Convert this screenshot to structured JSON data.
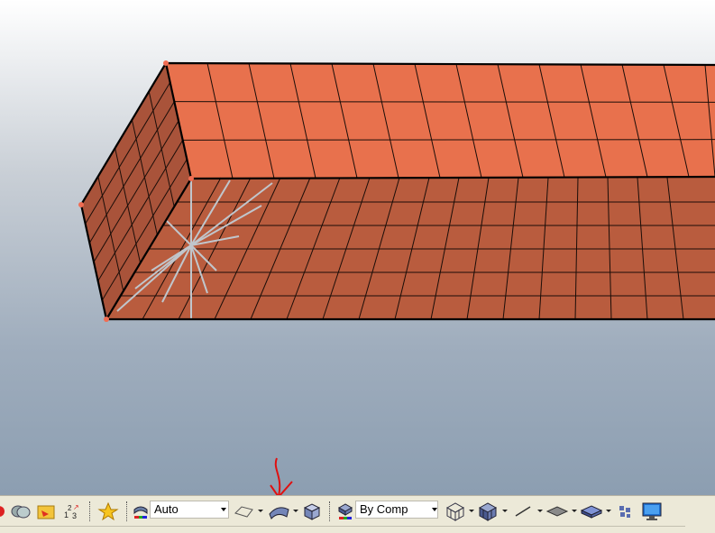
{
  "toolbar": {
    "element_color_mode": {
      "value": "Auto"
    },
    "component_color_mode": {
      "value": "By Comp"
    }
  },
  "colors": {
    "mesh_top": "#e8714d",
    "mesh_front": "#b95c3e",
    "mesh_side": "#a9533a",
    "mesh_line": "#1a0d08",
    "annotation_arrow": "#e01010",
    "toolbar_bg": "#ece9d8"
  },
  "icons": [
    "render-icon",
    "geometry-icon",
    "folder-icon",
    "numbering-icon",
    "favorite-star-icon",
    "element-color-icon",
    "wire-shape-icon",
    "shaded-surface-icon",
    "solid-box-icon",
    "by-comp-icon",
    "wireframe-cube-icon",
    "shaded-cube-icon",
    "line-icon",
    "plane-icon",
    "shell-icon",
    "mesh-nodes-icon",
    "monitor-icon"
  ]
}
